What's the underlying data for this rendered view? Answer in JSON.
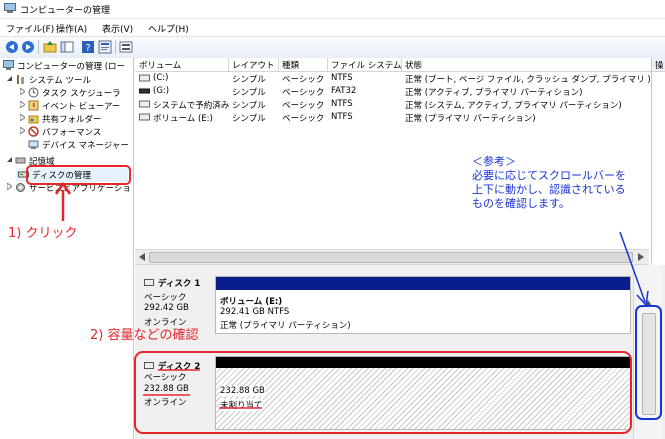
{
  "window": {
    "title": "コンピューターの管理"
  },
  "menu": [
    {
      "label": "ファイル(F)"
    },
    {
      "label": "操作(A)"
    },
    {
      "label": "表示(V)"
    },
    {
      "label": "ヘルプ(H)"
    }
  ],
  "tree": {
    "root": "コンピューターの管理 (ロー",
    "system_tools": "システム ツール",
    "task_scheduler": "タスク スケジューラ",
    "event_viewer": "イベント ビューアー",
    "shared_folders": "共有フォルダー",
    "performance": "パフォーマンス",
    "device_manager": "デバイス マネージャー",
    "storage": "記憶域",
    "disk_management": "ディスクの管理",
    "services": "サービスとアプリケーショ"
  },
  "columns": [
    "ボリューム",
    "レイアウト",
    "種類",
    "ファイル システム",
    "状態"
  ],
  "volumes": [
    {
      "name": "(C:)",
      "layout": "シンプル",
      "type": "ベーシック",
      "fs": "NTFS",
      "status": "正常 (ブート, ページ ファイル, クラッシュ ダンプ, プライマリ )"
    },
    {
      "name": "(G:)",
      "layout": "シンプル",
      "type": "ベーシック",
      "fs": "FAT32",
      "status": "正常 (アクティブ, プライマリ パーティション)"
    },
    {
      "name": "システムで予約済み",
      "layout": "シンプル",
      "type": "ベーシック",
      "fs": "NTFS",
      "status": "正常 (システム, アクティブ, プライマリ パーティション)"
    },
    {
      "name": "ボリューム (E:)",
      "layout": "シンプル",
      "type": "ベーシック",
      "fs": "NTFS",
      "status": "正常 (プライマリ パーティション)"
    }
  ],
  "action_pane_header": "操",
  "disks": [
    {
      "name": "ディスク 1",
      "type": "ベーシック",
      "size": "292.42 GB",
      "status": "オンライン",
      "partition": {
        "title": "ボリューム (E:)",
        "size_fs": "292.41 GB NTFS",
        "status": "正常 (プライマリ パーティション)"
      }
    },
    {
      "name": "ディスク 2",
      "type": "ベーシック",
      "size": "232.88 GB",
      "status": "オンライン",
      "partition": {
        "size": "232.88 GB",
        "status": "未割り当て"
      }
    }
  ],
  "annotations": {
    "step1": "1) クリック",
    "step2": "2) 容量などの確認",
    "note_title": "＜参考＞",
    "note_line1": "必要に応じてスクロールバーを",
    "note_line2": "上下に動かし、認識されている",
    "note_line3": "ものを確認します。"
  },
  "colors": {
    "annotation_red": "#e6262b",
    "annotation_blue": "#1a33d1",
    "primary_partition_bar": "#0a1d8c",
    "unallocated_bar": "#000000",
    "toolbar_blue": "#2c6fd1"
  }
}
